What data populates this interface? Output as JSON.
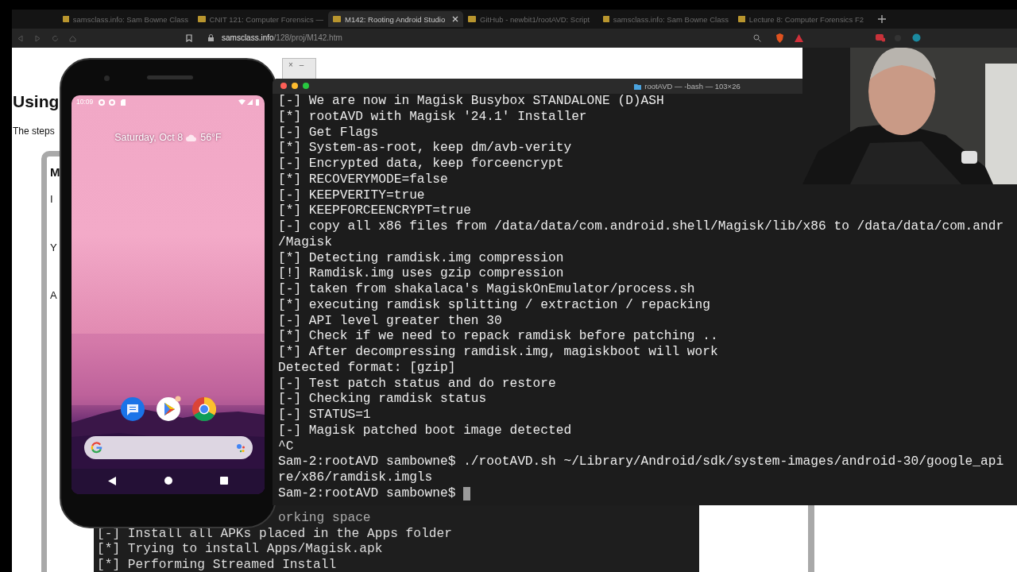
{
  "browser": {
    "tabs": [
      {
        "title": "samsclass.info: Sam Bowne Class",
        "selected": false
      },
      {
        "title": "CNIT 121: Computer Forensics —",
        "selected": false
      },
      {
        "title": "M142: Rooting Android Studio",
        "selected": true
      },
      {
        "title": "GitHub - newbit1/rootAVD: Script",
        "selected": false
      },
      {
        "title": "samsclass.info: Sam Bowne Class",
        "selected": false
      },
      {
        "title": "Lecture 8: Computer Forensics F2",
        "selected": false
      }
    ],
    "url_host": "samsclass.info",
    "url_path": "/128/proj/M142.htm"
  },
  "web_page": {
    "heading": "Using",
    "intro": "The steps",
    "box_title": "M",
    "box_lines": [
      "I",
      "Y",
      "A"
    ]
  },
  "small_window": {
    "buttons": [
      "×",
      "–"
    ]
  },
  "phone": {
    "time": "10:09",
    "date": "Saturday, Oct 8",
    "temperature": "56°F"
  },
  "terminal": {
    "title": "rootAVD — -bash — 103×26",
    "cursor_visible": true,
    "lines": [
      "[-] We are now in Magisk Busybox STANDALONE (D)ASH",
      "[*] rootAVD with Magisk '24.1' Installer",
      "[-] Get Flags",
      "[*] System-as-root, keep dm/avb-verity",
      "[-] Encrypted data, keep forceencrypt",
      "[*] RECOVERYMODE=false",
      "[-] KEEPVERITY=true",
      "[*] KEEPFORCEENCRYPT=true",
      "[-] copy all x86 files from /data/data/com.android.shell/Magisk/lib/x86 to /data/data/com.andr",
      "/Magisk",
      "[*] Detecting ramdisk.img compression",
      "[!] Ramdisk.img uses gzip compression",
      "[-] taken from shakalaca's MagiskOnEmulator/process.sh",
      "[*] executing ramdisk splitting / extraction / repacking",
      "[-] API level greater then 30",
      "[*] Check if we need to repack ramdisk before patching ..",
      "[*] After decompressing ramdisk.img, magiskboot will work",
      "Detected format: [gzip]",
      "[-] Test patch status and do restore",
      "[-] Checking ramdisk status",
      "[-] STATUS=1",
      "[-] Magisk patched boot image detected",
      "^C",
      "Sam-2:rootAVD sambowne$ ./rootAVD.sh ~/Library/Android/sdk/system-images/android-30/google_api",
      "re/x86/ramdisk.imgls",
      "Sam-2:rootAVD sambowne$ "
    ]
  },
  "back_terminal": {
    "lines": [
      "orking space",
      "[-] Install all APKs placed in the Apps folder",
      "[*] Trying to install Apps/Magisk.apk",
      "[*] Performing Streamed Install"
    ]
  }
}
